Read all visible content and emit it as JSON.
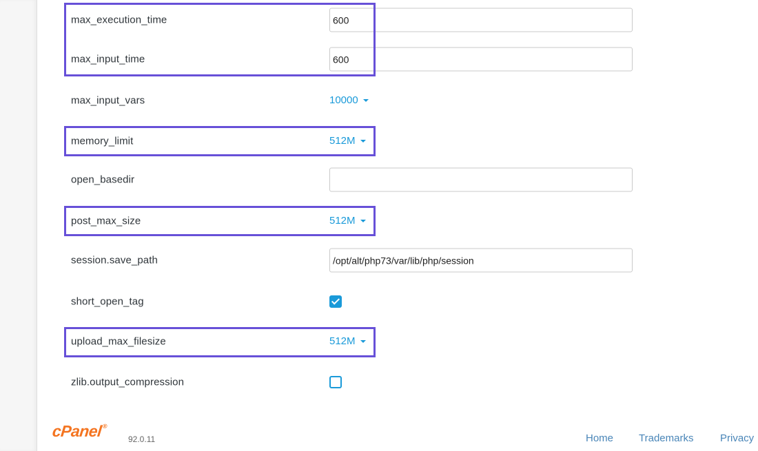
{
  "settings": {
    "max_execution_time": {
      "label": "max_execution_time",
      "value": "600"
    },
    "max_input_time": {
      "label": "max_input_time",
      "value": "600"
    },
    "max_input_vars": {
      "label": "max_input_vars",
      "value": "10000"
    },
    "memory_limit": {
      "label": "memory_limit",
      "value": "512M"
    },
    "open_basedir": {
      "label": "open_basedir",
      "value": ""
    },
    "post_max_size": {
      "label": "post_max_size",
      "value": "512M"
    },
    "session_save_path": {
      "label": "session.save_path",
      "value": "/opt/alt/php73/var/lib/php/session"
    },
    "short_open_tag": {
      "label": "short_open_tag",
      "checked": true
    },
    "upload_max_filesize": {
      "label": "upload_max_filesize",
      "value": "512M"
    },
    "zlib_output_compression": {
      "label": "zlib.output_compression",
      "checked": false
    }
  },
  "highlight_color": "#6750d8",
  "accent_color": "#1a9ad9",
  "footer": {
    "logo_text": "cPanel",
    "logo_mark": "®",
    "version": "92.0.11",
    "links": {
      "home": "Home",
      "trademarks": "Trademarks",
      "privacy": "Privacy"
    }
  }
}
